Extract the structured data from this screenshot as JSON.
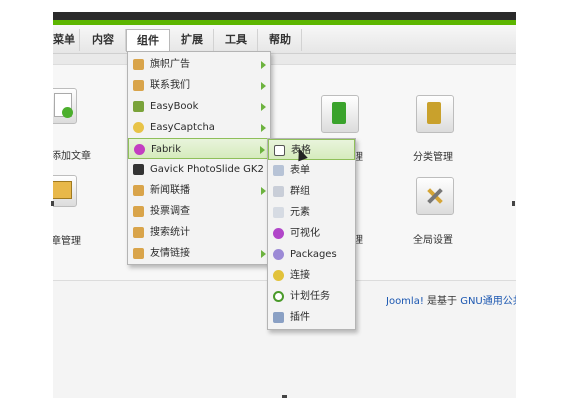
{
  "menu": {
    "items": [
      {
        "label": "菜单"
      },
      {
        "label": "内容"
      },
      {
        "label": "组件"
      },
      {
        "label": "扩展"
      },
      {
        "label": "工具"
      },
      {
        "label": "帮助"
      }
    ]
  },
  "cpanel": {
    "left_labels": [
      "添加文章",
      "章管理"
    ],
    "right_labels": [
      "理",
      "分类管理",
      "理",
      "全局设置"
    ]
  },
  "components_menu": {
    "items": [
      {
        "label": "旗帜广告",
        "icon": "folder-icon",
        "has_submenu": true
      },
      {
        "label": "联系我们",
        "icon": "folder-icon",
        "has_submenu": true
      },
      {
        "label": "EasyBook",
        "icon": "book-icon",
        "has_submenu": true
      },
      {
        "label": "EasyCaptcha",
        "icon": "captcha-icon",
        "has_submenu": true
      },
      {
        "label": "Fabrik",
        "icon": "fabrik-icon",
        "has_submenu": true
      },
      {
        "label": "Gavick PhotoSlide GK2",
        "icon": "camera-icon",
        "has_submenu": false
      },
      {
        "label": "新闻联播",
        "icon": "folder-icon",
        "has_submenu": true
      },
      {
        "label": "投票调查",
        "icon": "folder-icon",
        "has_submenu": false
      },
      {
        "label": "搜索统计",
        "icon": "folder-icon",
        "has_submenu": false
      },
      {
        "label": "友情链接",
        "icon": "folder-icon",
        "has_submenu": true
      }
    ]
  },
  "fabrik_menu": {
    "items": [
      {
        "label": "表格",
        "icon": "table-icon"
      },
      {
        "label": "表单",
        "icon": "form-icon"
      },
      {
        "label": "群组",
        "icon": "group-icon"
      },
      {
        "label": "元素",
        "icon": "element-icon"
      },
      {
        "label": "可视化",
        "icon": "visualization-icon"
      },
      {
        "label": "Packages",
        "icon": "package-icon"
      },
      {
        "label": "连接",
        "icon": "connection-icon"
      },
      {
        "label": "计划任务",
        "icon": "clock-icon"
      },
      {
        "label": "插件",
        "icon": "plugin-icon"
      }
    ]
  },
  "footer": {
    "link1": "Joomla!",
    "text": " 是基于 ",
    "link2": "GNU通用公共"
  },
  "colors": {
    "accent_green": "#5cb500",
    "link_blue": "#1b57b1"
  }
}
